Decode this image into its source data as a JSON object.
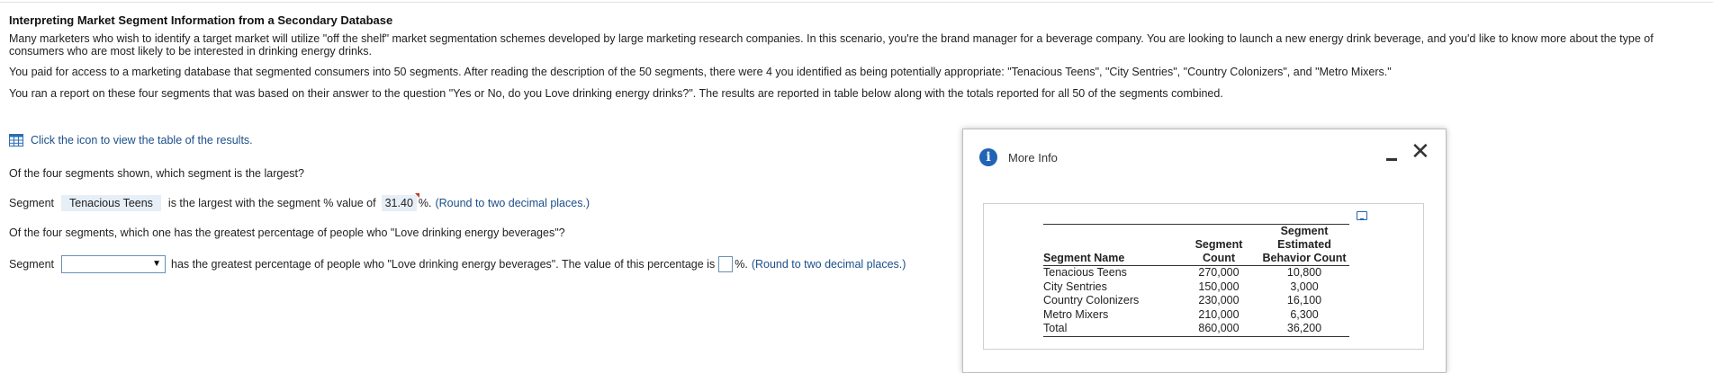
{
  "title": "Interpreting Market Segment Information from a Secondary Database",
  "paragraphs": [
    "Many marketers who wish to identify a target market will utilize \"off the shelf\" market segmentation schemes developed by large marketing research companies. In this scenario, you're the brand manager for a beverage company. You are looking to launch a new energy drink beverage, and you'd like to know more about the type of consumers who are most likely to be interested in drinking energy drinks.",
    "You paid for access to a marketing database that segmented consumers into 50 segments. After reading the description of the 50 segments, there were 4 you identified as being potentially appropriate: \"Tenacious Teens\", \"City Sentries\", \"Country Colonizers\", and \"Metro Mixers.\"",
    "You ran a report on these four segments that was based on their answer to the question \"Yes or No, do you Love drinking energy drinks?\". The results are reported in table below along with the totals reported for all 50 of the segments combined."
  ],
  "view_table_link": "Click the icon to view the table of the results.",
  "question1": "Of the four segments shown, which segment is the largest?",
  "answer1": {
    "prefix": "Segment",
    "segment_value": "Tenacious Teens",
    "middle": "is the largest with the segment % value of",
    "percent_value": "31.40",
    "suffix": "%.",
    "hint": "(Round to two decimal places.)"
  },
  "question2": "Of the four segments, which one has the greatest percentage of people who \"Love drinking energy beverages\"?",
  "answer2": {
    "prefix": "Segment",
    "select_value": "",
    "middle": "has the greatest percentage of people who \"Love drinking energy beverages\". The value of this percentage is",
    "input_value": "",
    "suffix": "%.",
    "hint": "(Round to two decimal places.)"
  },
  "dialog": {
    "title": "More Info",
    "headers": [
      "Segment Name",
      "Segment Count",
      "Segment Estimated Behavior Count"
    ],
    "rows": [
      [
        "Tenacious Teens",
        "270,000",
        "10,800"
      ],
      [
        "City Sentries",
        "150,000",
        "3,000"
      ],
      [
        "Country Colonizers",
        "230,000",
        "16,100"
      ],
      [
        "Metro Mixers",
        "210,000",
        "6,300"
      ],
      [
        "Total",
        "860,000",
        "36,200"
      ]
    ]
  },
  "icons": {
    "table": "table-grid-icon",
    "info": "info-icon",
    "minimize": "minimize-icon",
    "close": "close-icon",
    "copy": "copy-icon",
    "dropdown": "dropdown-arrow-icon"
  },
  "colors": {
    "link": "#1a4e8a",
    "answer_bg": "#e6eef7",
    "info_blue": "#2164b4",
    "flag_red": "#c0392b"
  }
}
